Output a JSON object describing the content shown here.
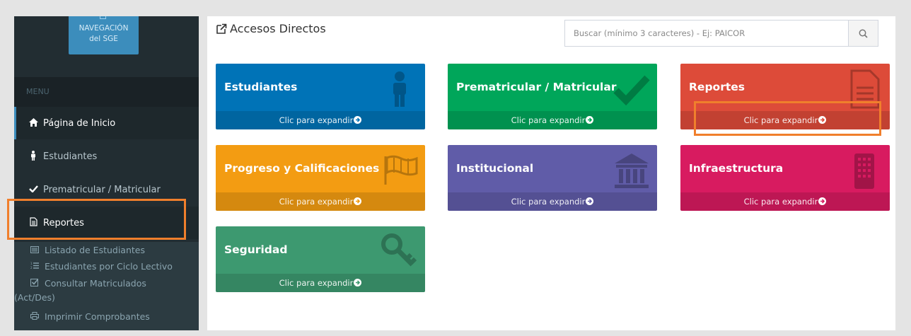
{
  "sidebar": {
    "nav_sge": {
      "line1": "NAVEGACIÓN",
      "line2": "del SGE"
    },
    "menu_header": "MENU",
    "items": [
      {
        "label": "Página de Inicio",
        "icon": "home-icon"
      },
      {
        "label": "Estudiantes",
        "icon": "student-icon"
      },
      {
        "label": "Prematricular / Matricular",
        "icon": "check-icon"
      },
      {
        "label": "Reportes",
        "icon": "file-text-icon"
      }
    ],
    "sub_items": [
      {
        "label": "Listado de Estudiantes",
        "icon": "list-alt-icon"
      },
      {
        "label": "Estudiantes por Ciclo Lectivo",
        "icon": "list-ol-icon"
      },
      {
        "label": "Consultar Matriculados",
        "label2": "(Act/Des)",
        "icon": "check-square-icon"
      },
      {
        "label": "Imprimir Comprobantes",
        "icon": "print-icon"
      }
    ]
  },
  "content": {
    "title": "Accesos Directos",
    "search_placeholder": "Buscar (mínimo 3 caracteres) - Ej: PAICOR"
  },
  "tiles": [
    {
      "title": "Estudiantes",
      "footer": "Clic para expandir",
      "color": "#0073b7",
      "icon": "student-icon"
    },
    {
      "title": "Prematricular / Matricular",
      "footer": "Clic para expandir",
      "color": "#00a65a",
      "icon": "check-icon"
    },
    {
      "title": "Reportes",
      "footer": "Clic para expandir",
      "color": "#dd4b39",
      "icon": "file-text-icon"
    },
    {
      "title": "Progreso y Calificaciones",
      "footer": "Clic para expandir",
      "color": "#f39c12",
      "icon": "flag-icon"
    },
    {
      "title": "Institucional",
      "footer": "Clic para expandir",
      "color": "#605ca8",
      "icon": "institution-icon"
    },
    {
      "title": "Infraestructura",
      "footer": "Clic para expandir",
      "color": "#d81b60",
      "icon": "building-icon"
    },
    {
      "title": "Seguridad",
      "footer": "Clic para expandir",
      "color": "#3d9970",
      "icon": "key-icon"
    }
  ],
  "colors": {
    "sidebar_bg": "#222d32",
    "accent": "#3c8dbc",
    "highlight": "#f07f2c"
  }
}
